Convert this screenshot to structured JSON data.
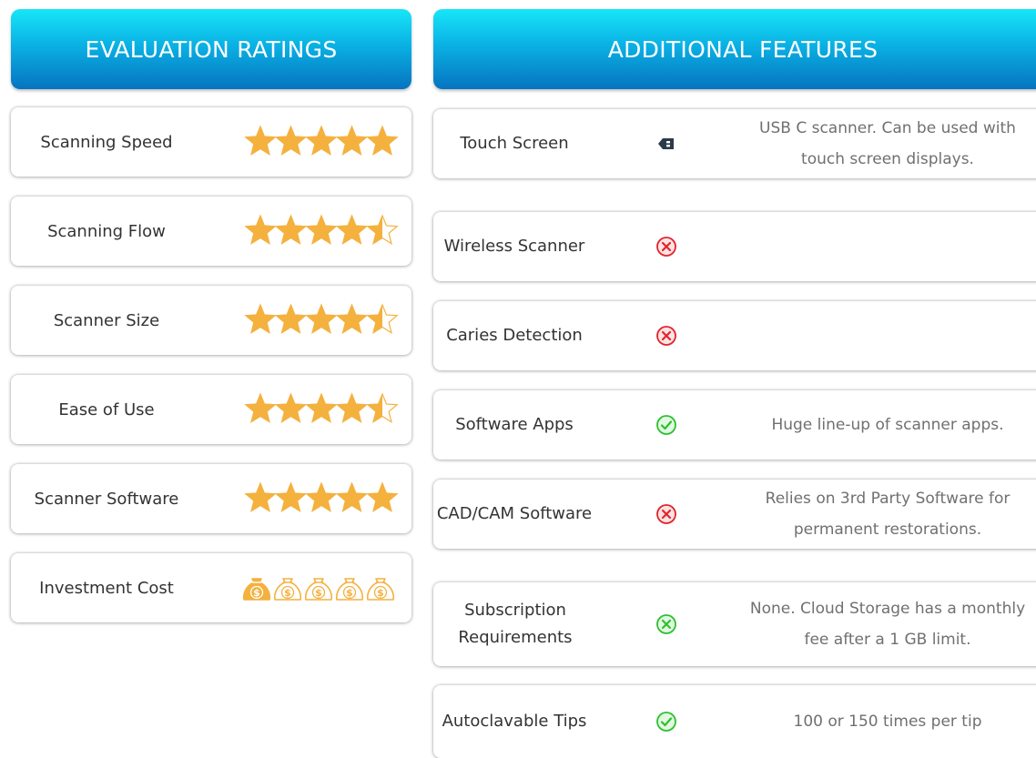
{
  "evaluation": {
    "title": "EVALUATION RATINGS",
    "ratings": [
      {
        "label": "Scanning Speed",
        "stars": 5
      },
      {
        "label": "Scanning Flow",
        "stars": 4.5
      },
      {
        "label": "Scanner Size",
        "stars": 4.5
      },
      {
        "label": "Ease of Use",
        "stars": 4.5
      },
      {
        "label": "Scanner Software",
        "stars": 5
      },
      {
        "label": "Investment Cost",
        "money_bags_filled": 1,
        "money_bags_total": 5
      }
    ]
  },
  "features": {
    "title": "ADDITIONAL FEATURES",
    "items": [
      {
        "label": "Touch Screen",
        "status_icon": "usb-icon",
        "note": "USB C scanner. Can be used with touch screen displays."
      },
      {
        "label": "Wireless Scanner",
        "status_icon": "red-x-circle-icon",
        "note": ""
      },
      {
        "label": "Caries Detection",
        "status_icon": "red-x-circle-icon",
        "note": ""
      },
      {
        "label": "Software Apps",
        "status_icon": "green-check-circle-icon",
        "note": "Huge line-up of scanner apps."
      },
      {
        "label": "CAD/CAM Software",
        "status_icon": "red-x-circle-icon",
        "note": "Relies on 3rd Party Software for permanent restorations."
      },
      {
        "label": "Subscription Requirements",
        "status_icon": "green-x-circle-icon",
        "note": "None. Cloud Storage has a monthly fee after a 1 GB limit."
      },
      {
        "label": "Autoclavable Tips",
        "status_icon": "green-check-circle-icon",
        "note": "100 or 150 times per tip"
      }
    ]
  },
  "colors": {
    "header_top": "#17e6f8",
    "header_bottom": "#0674c0",
    "star": "#f4b13e",
    "star_empty_outline": "#f4b13e",
    "red_icon": "#e0242c",
    "green_icon": "#2fbf2f"
  }
}
